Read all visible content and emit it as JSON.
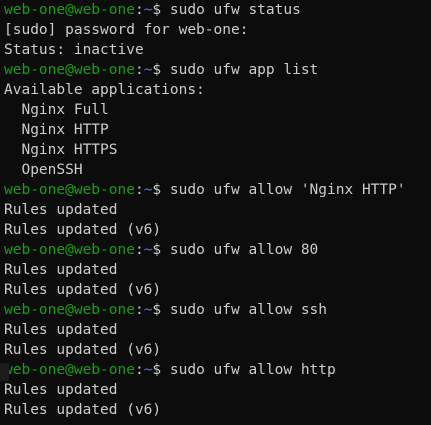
{
  "prompt": {
    "user": "web-one@web-one",
    "sep": ":",
    "path": "~",
    "dollar": "$"
  },
  "lines": [
    {
      "type": "cmd",
      "text": " sudo ufw status"
    },
    {
      "type": "out",
      "text": "[sudo] password for web-one:"
    },
    {
      "type": "out",
      "text": "Status: inactive"
    },
    {
      "type": "cmd",
      "text": " sudo ufw app list"
    },
    {
      "type": "out",
      "text": "Available applications:"
    },
    {
      "type": "out",
      "text": "  Nginx Full"
    },
    {
      "type": "out",
      "text": "  Nginx HTTP"
    },
    {
      "type": "out",
      "text": "  Nginx HTTPS"
    },
    {
      "type": "out",
      "text": "  OpenSSH"
    },
    {
      "type": "cmd",
      "text": " sudo ufw allow 'Nginx HTTP'"
    },
    {
      "type": "out",
      "text": "Rules updated"
    },
    {
      "type": "out",
      "text": "Rules updated (v6)"
    },
    {
      "type": "cmd",
      "text": " sudo ufw allow 80"
    },
    {
      "type": "out",
      "text": "Rules updated"
    },
    {
      "type": "out",
      "text": "Rules updated (v6)"
    },
    {
      "type": "cmd",
      "text": " sudo ufw allow ssh"
    },
    {
      "type": "out",
      "text": "Rules updated"
    },
    {
      "type": "out",
      "text": "Rules updated (v6)"
    },
    {
      "type": "cmd",
      "text": " sudo ufw allow http"
    },
    {
      "type": "out",
      "text": "Rules updated"
    },
    {
      "type": "out",
      "text": "Rules updated (v6)"
    }
  ],
  "colors": {
    "background": "#0c0c0c",
    "text": "#cccccc",
    "user": "#13a10e",
    "path": "#3b78ff"
  }
}
